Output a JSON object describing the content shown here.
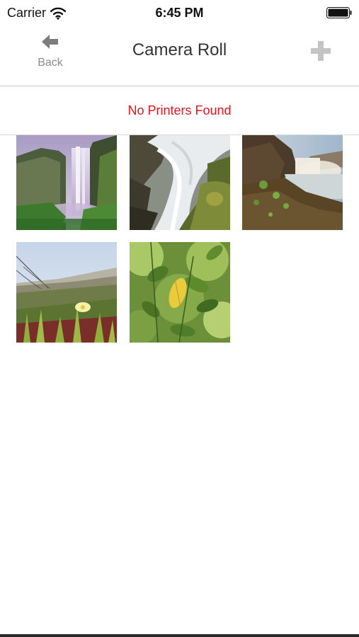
{
  "status_bar": {
    "carrier": "Carrier",
    "time": "6:45 PM",
    "icons": [
      "wifi-icon",
      "battery-icon"
    ]
  },
  "nav": {
    "back_label": "Back",
    "title": "Camera Roll",
    "back_icon": "arrow-left-icon",
    "add_icon": "plus-icon"
  },
  "printer_status": {
    "message": "No Printers Found",
    "color": "#e8141e"
  },
  "photos": [
    {
      "subject": "waterfall-valley"
    },
    {
      "subject": "waterfall-closeup"
    },
    {
      "subject": "waterfall-cliff"
    },
    {
      "subject": "beach-dune-flowers"
    },
    {
      "subject": "green-leaves"
    }
  ]
}
